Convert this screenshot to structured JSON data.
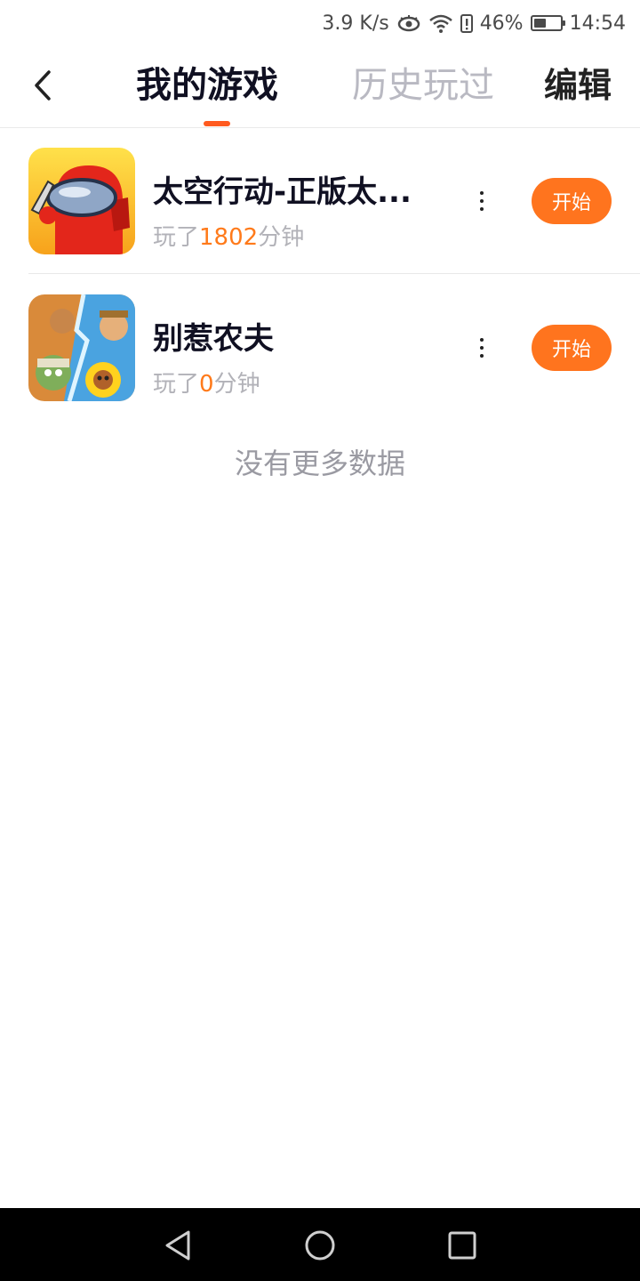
{
  "status_bar": {
    "speed": "3.9 K/s",
    "battery_percent": "46%",
    "battery_level": 0.46,
    "time": "14:54",
    "icons": [
      "eye-icon",
      "wifi-icon",
      "battery-alert-icon",
      "battery-icon"
    ]
  },
  "header": {
    "tabs": [
      {
        "label": "我的游戏",
        "active": true
      },
      {
        "label": "历史玩过",
        "active": false
      }
    ],
    "edit_label": "编辑",
    "accent_color": "#ff5a1f"
  },
  "games": [
    {
      "title": "太空行动-正版太...",
      "meta_prefix": "玩了",
      "minutes": "1802",
      "meta_suffix": "分钟",
      "start_label": "开始"
    },
    {
      "title": "别惹农夫",
      "meta_prefix": "玩了",
      "minutes": "0",
      "meta_suffix": "分钟",
      "start_label": "开始"
    }
  ],
  "footer": {
    "no_more_text": "没有更多数据"
  },
  "colors": {
    "start_button": "#ff741e",
    "highlight": "#ff7a1a"
  }
}
